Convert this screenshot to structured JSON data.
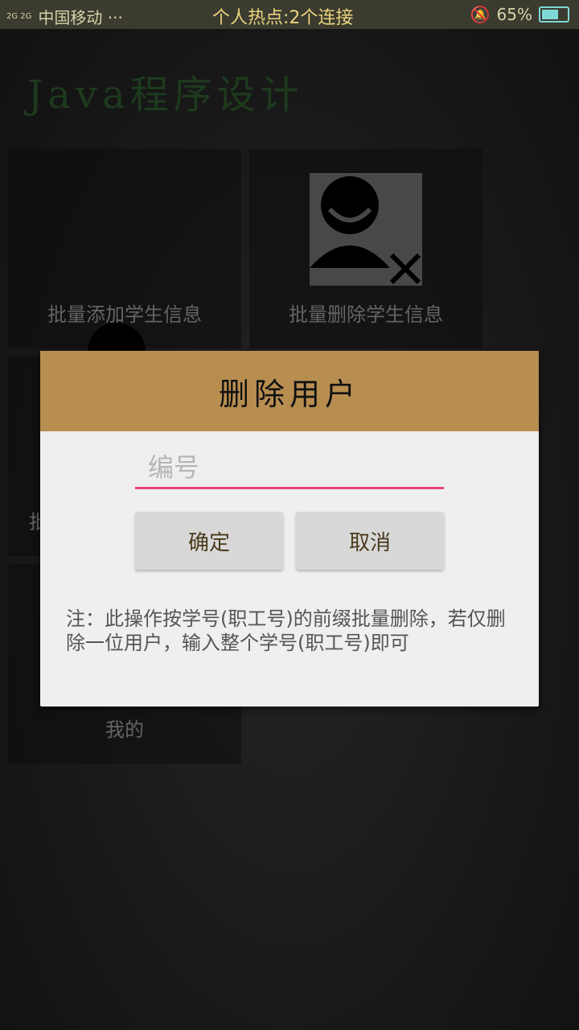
{
  "status_bar": {
    "network": "2G 2G",
    "carrier": "中国移动 ···",
    "center_text": "个人热点:2个连接",
    "battery_text": "65%",
    "battery_level": 0.65
  },
  "app": {
    "title": "Java程序设计"
  },
  "tiles": [
    {
      "label": "批量添加学生信息",
      "icon": "add-user-icon"
    },
    {
      "label": "批量删除学生信息",
      "icon": "remove-user-icon"
    },
    {
      "label": "批"
    },
    {
      "label": "我的"
    }
  ],
  "dialog": {
    "title": "删除用户",
    "input_placeholder": "编号",
    "confirm_label": "确定",
    "cancel_label": "取消",
    "note": "注：此操作按学号(职工号)的前缀批量删除，若仅删除一位用户，输入整个学号(职工号)即可"
  },
  "colors": {
    "header": "#b88e50",
    "input_underline": "#e8447f"
  }
}
